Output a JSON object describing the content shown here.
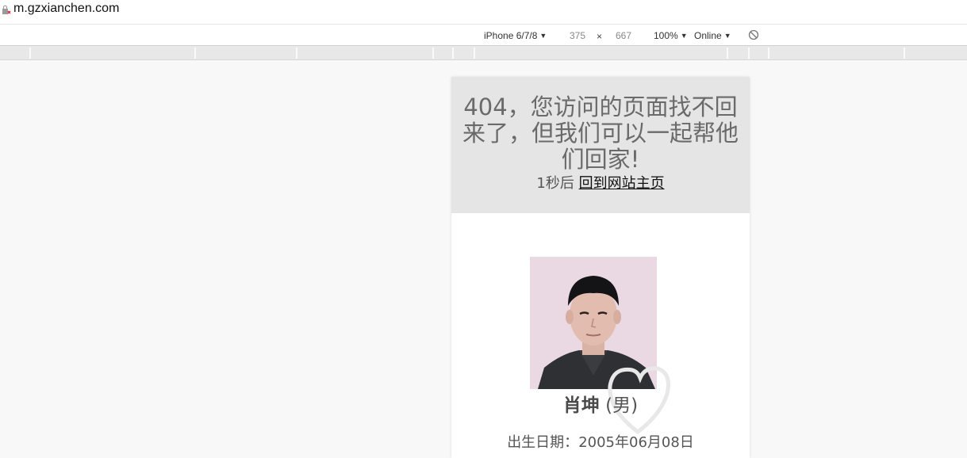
{
  "browser": {
    "url": "m.gzxianchen.com"
  },
  "device_toolbar": {
    "device": "iPhone 6/7/8",
    "width": "375",
    "times": "×",
    "height": "667",
    "zoom": "100%",
    "network": "Online",
    "caret": "▼"
  },
  "page": {
    "headline": "404，您访问的页面找不回来了，但我们可以一起帮他们回家!",
    "countdown_prefix": "1秒后",
    "home_link": "回到网站主页",
    "person": {
      "name": "肖坤",
      "gender": "(男)",
      "birth_label": "出生日期：",
      "birth_date": "2005年06月08日"
    }
  },
  "colors": {
    "banner_bg": "#e5e5e5",
    "headline_text": "#6a6a6a",
    "page_bg": "#f8f8f8"
  },
  "icons": [
    "insecure-lock-icon",
    "rotate-icon",
    "watermark-heart-icon"
  ]
}
